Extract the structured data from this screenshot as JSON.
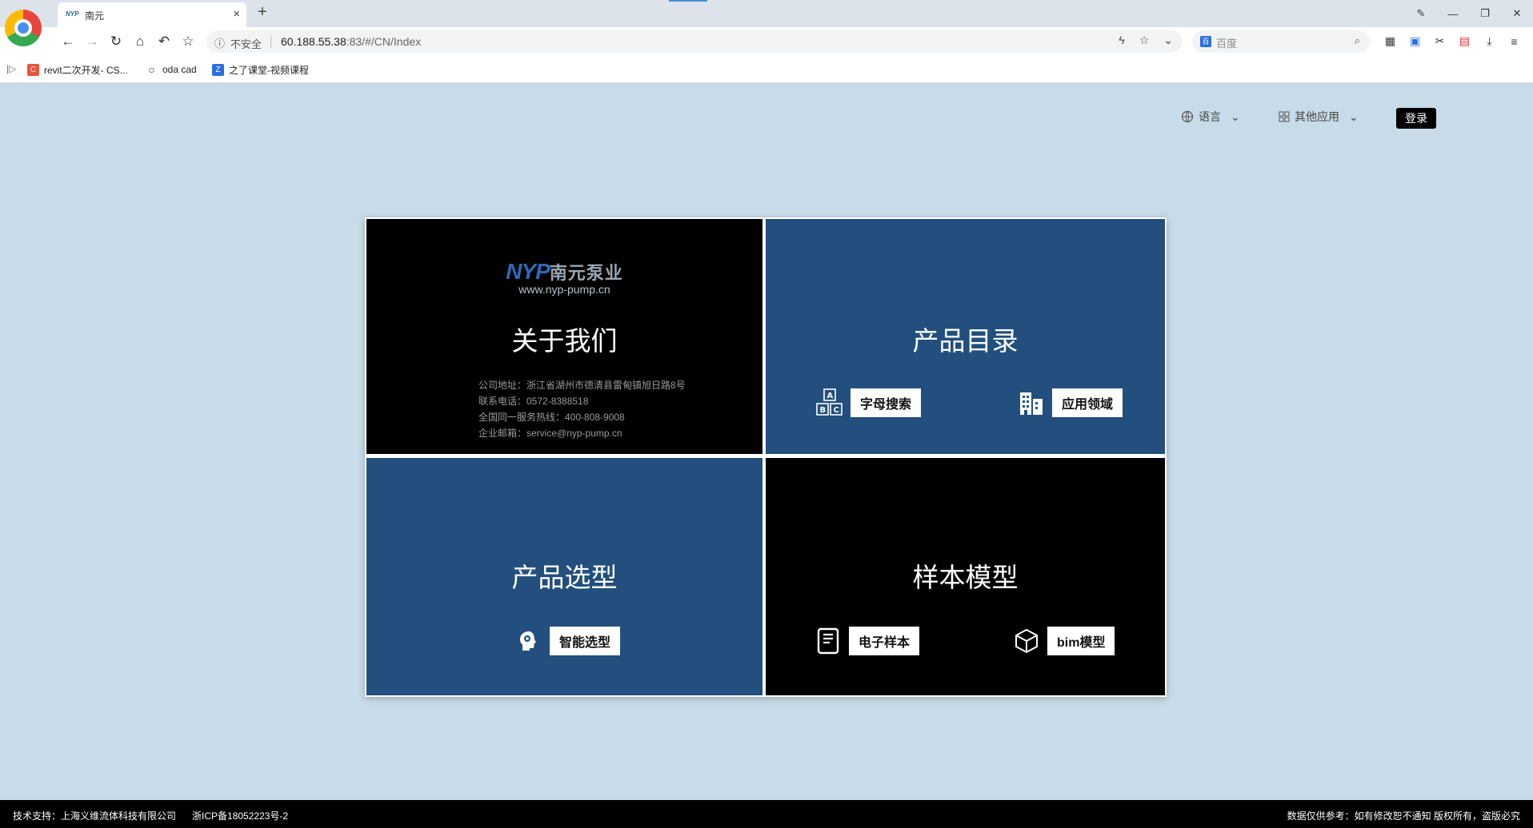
{
  "browser": {
    "tab_title": "南元",
    "tab_favicon": "NYP",
    "address_security": "不安全",
    "address_host": "60.188.55.38",
    "address_rest": ":83/#/CN/Index",
    "search_placeholder": "百度",
    "bookmarks": [
      {
        "label": "revit二次开发- CS...",
        "icon": "C",
        "color": "#e8543c"
      },
      {
        "label": "oda cad",
        "icon": "○",
        "color": "#1a2a6c"
      },
      {
        "label": "之了课堂-视频课程",
        "icon": "Z",
        "color": "#2a6fe0"
      }
    ]
  },
  "topnav": {
    "language": "语言",
    "other_apps": "其他应用",
    "login": "登录"
  },
  "about": {
    "logo_brand": "NYP",
    "logo_cn": "南元泵业",
    "logo_url": "www.nyp-pump.cn",
    "title": "关于我们",
    "address": "公司地址：浙江省湖州市德清县雷甸镇旭日路8号",
    "phone": "联系电话：0572-8388518",
    "hotline": "全国同一服务热线：400-808-9008",
    "email": "企业邮箱：service@nyp-pump.cn"
  },
  "catalog": {
    "title": "产品目录",
    "alpha_search": "字母搜索",
    "application": "应用领域"
  },
  "selection": {
    "title": "产品选型",
    "smart": "智能选型"
  },
  "samples": {
    "title": "样本模型",
    "ebook": "电子样本",
    "bim": "bim模型"
  },
  "footer": {
    "support": "技术支持：上海义维流体科技有限公司",
    "icp": "浙ICP备18052223号-2",
    "notice": "数据仅供参考：如有修改恕不通知 版权所有，盗版必究"
  },
  "colors": {
    "page_bg": "#c8dbe8",
    "tile_blue": "#224f7e",
    "tile_black": "#000000"
  }
}
